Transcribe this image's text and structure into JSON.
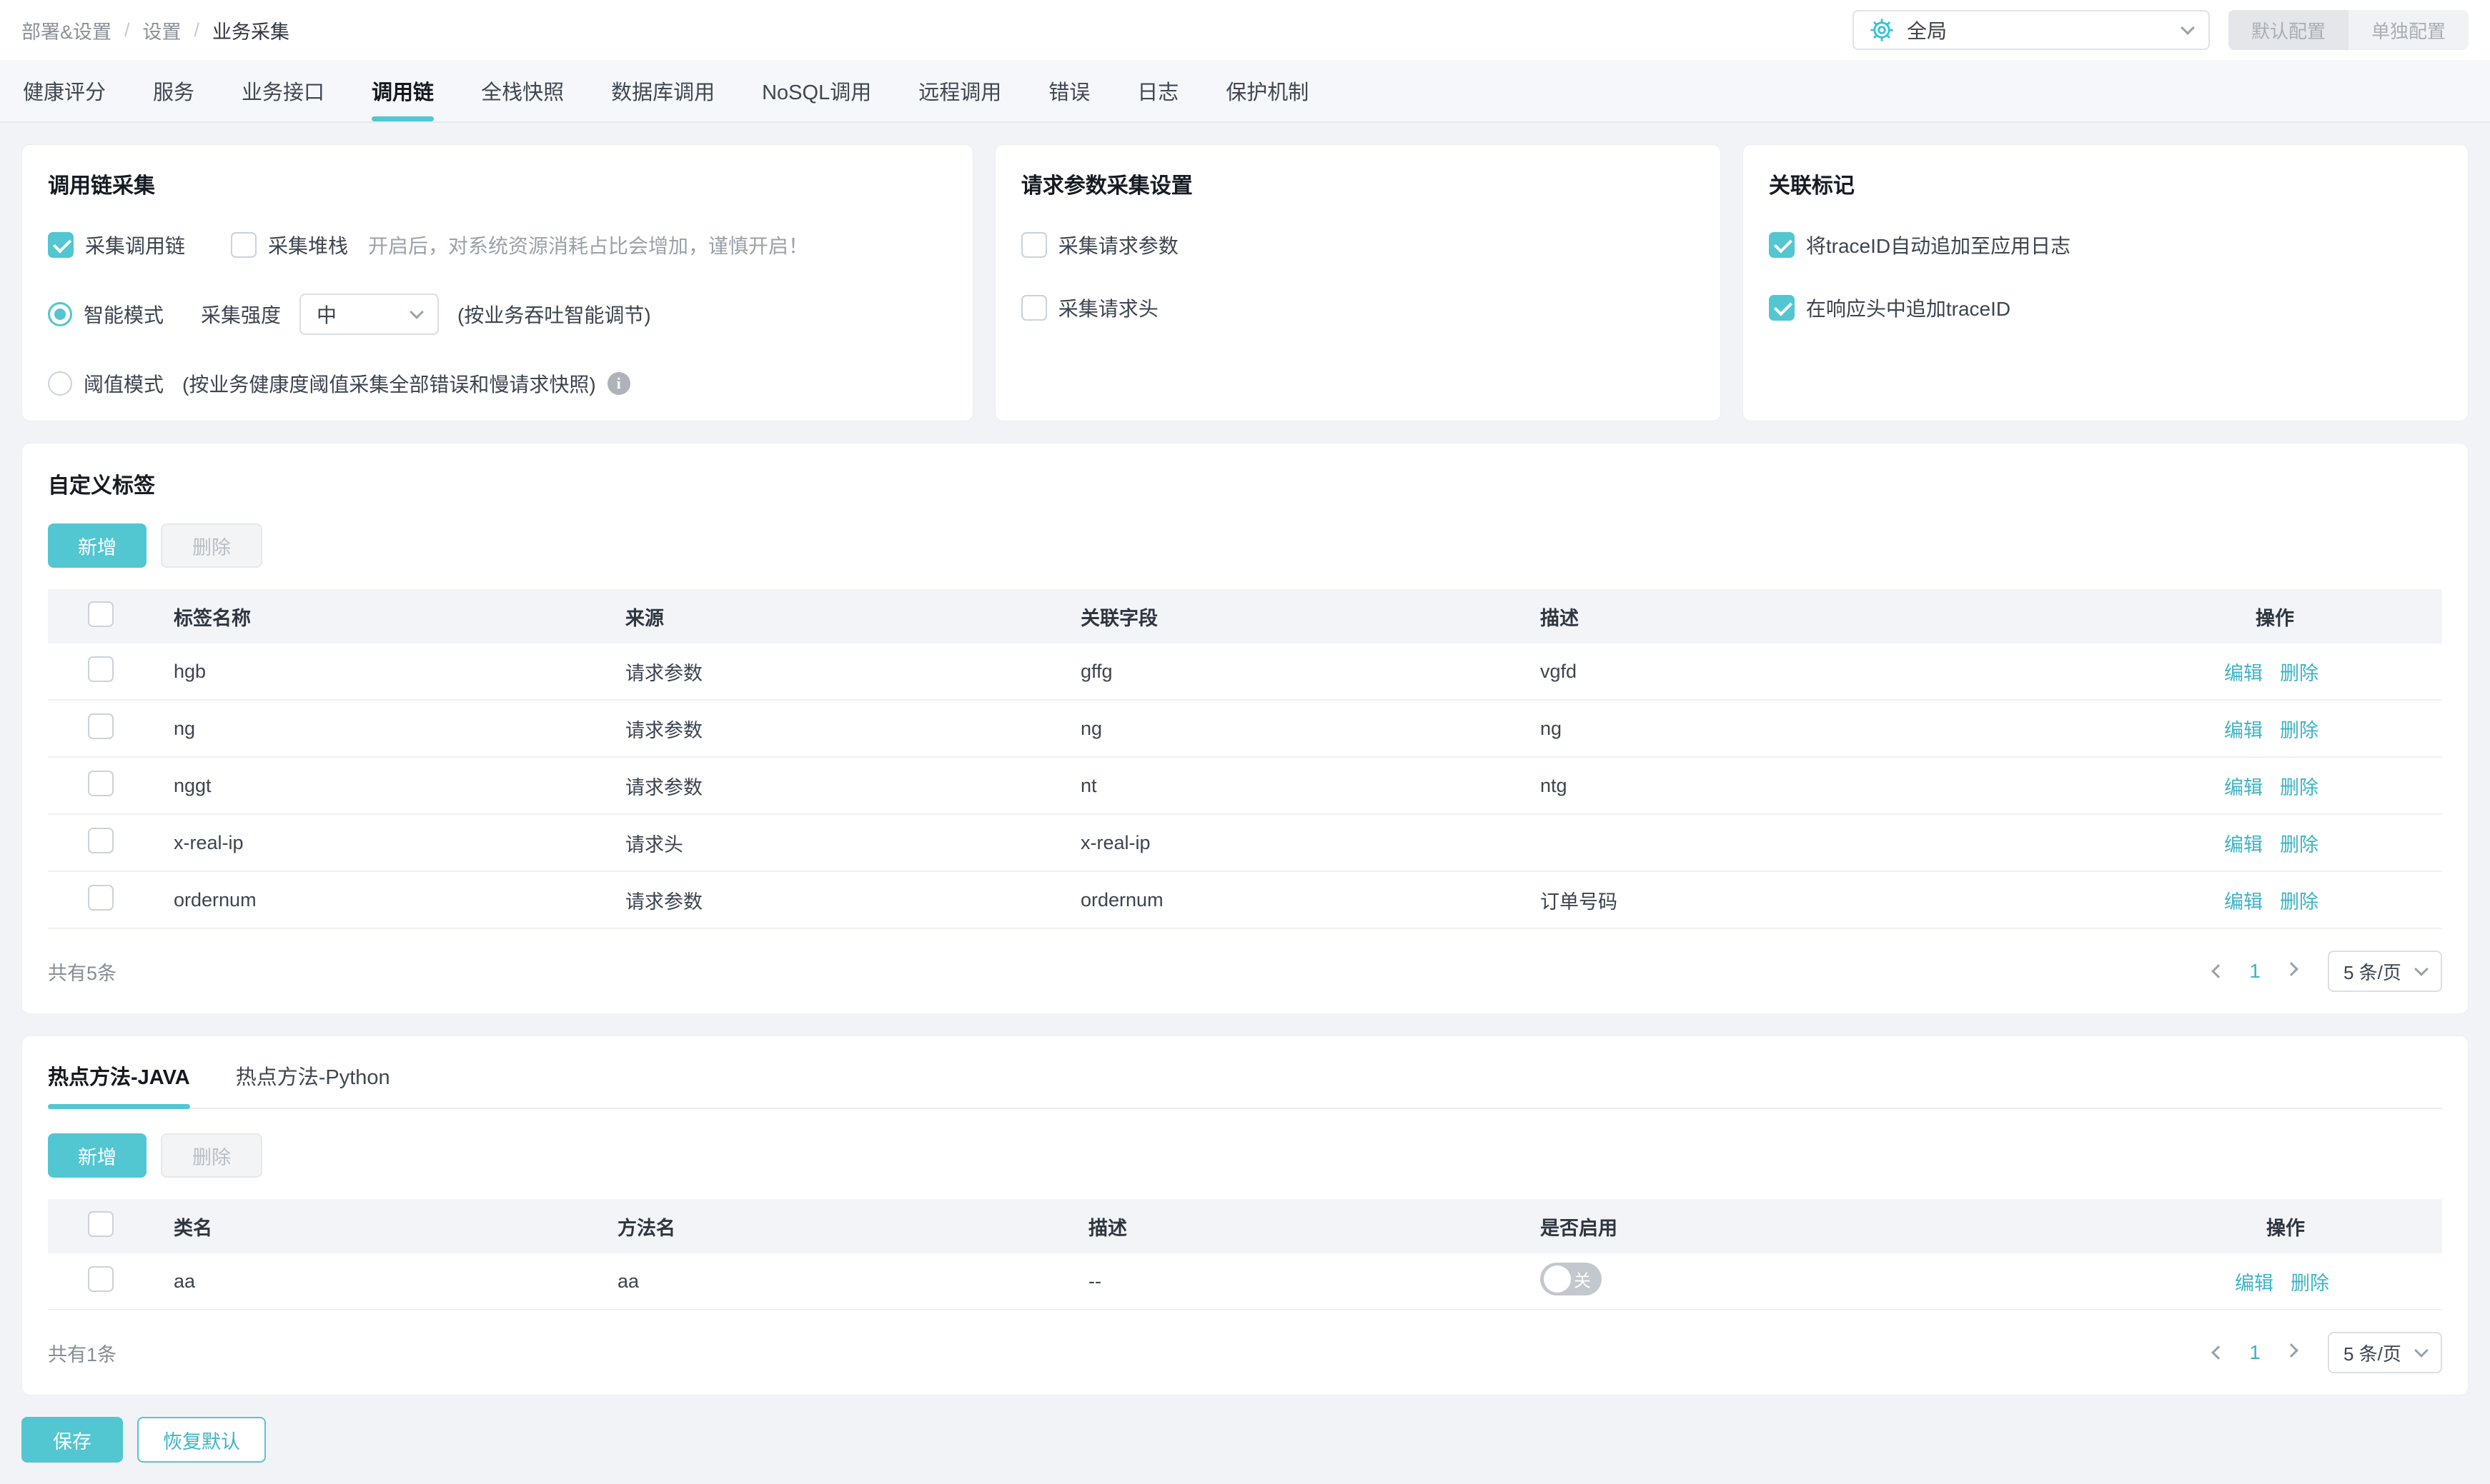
{
  "colors": {
    "accent": "#52c6d1",
    "link": "#3eb3c5"
  },
  "breadcrumb": {
    "items": [
      "部署&设置",
      "设置",
      "业务采集"
    ],
    "separator": "/"
  },
  "header": {
    "scope_value": "全局",
    "default_config_button": "默认配置",
    "separate_config_button": "单独配置"
  },
  "tabs": {
    "items": [
      "健康评分",
      "服务",
      "业务接口",
      "调用链",
      "全栈快照",
      "数据库调用",
      "NoSQL调用",
      "远程调用",
      "错误",
      "日志",
      "保护机制"
    ],
    "active": "调用链"
  },
  "panels": {
    "trace_collection": {
      "title": "调用链采集",
      "collect_trace_label": "采集调用链",
      "collect_trace_checked": true,
      "collect_stack_label": "采集堆栈",
      "collect_stack_checked": false,
      "stack_hint": "开启后，对系统资源消耗占比会增加，谨慎开启！",
      "smart_mode_label": "智能模式",
      "smart_mode_selected": true,
      "intensity_label": "采集强度",
      "intensity_value": "中",
      "smart_hint": "(按业务吞吐智能调节)",
      "threshold_mode_label": "阈值模式",
      "threshold_mode_selected": false,
      "threshold_hint": "(按业务健康度阈值采集全部错误和慢请求快照)",
      "info_glyph": "i"
    },
    "request_params": {
      "title": "请求参数采集设置",
      "collect_params_label": "采集请求参数",
      "collect_params_checked": false,
      "collect_headers_label": "采集请求头",
      "collect_headers_checked": false
    },
    "correlation": {
      "title": "关联标记",
      "append_log_label": "将traceID自动追加至应用日志",
      "append_log_checked": true,
      "append_header_label": "在响应头中追加traceID",
      "append_header_checked": true
    }
  },
  "custom_tags": {
    "title": "自定义标签",
    "add_button": "新增",
    "delete_button": "删除",
    "columns": [
      "标签名称",
      "来源",
      "关联字段",
      "描述",
      "操作"
    ],
    "edit_label": "编辑",
    "remove_label": "删除",
    "rows": [
      {
        "name": "hgb",
        "source": "请求参数",
        "field": "gffg",
        "desc": "vgfd"
      },
      {
        "name": "ng",
        "source": "请求参数",
        "field": "ng",
        "desc": "ng"
      },
      {
        "name": "nggt",
        "source": "请求参数",
        "field": "nt",
        "desc": "ntg"
      },
      {
        "name": "x-real-ip",
        "source": "请求头",
        "field": "x-real-ip",
        "desc": ""
      },
      {
        "name": "ordernum",
        "source": "请求参数",
        "field": "ordernum",
        "desc": "订单号码"
      }
    ],
    "total_text": "共有5条",
    "pagination": {
      "current_page": "1",
      "page_size": "5 条/页"
    }
  },
  "hot_methods": {
    "tabs": [
      "热点方法-JAVA",
      "热点方法-Python"
    ],
    "active_tab": "热点方法-JAVA",
    "add_button": "新增",
    "delete_button": "删除",
    "columns": [
      "类名",
      "方法名",
      "描述",
      "是否启用",
      "操作"
    ],
    "edit_label": "编辑",
    "remove_label": "删除",
    "rows": [
      {
        "class_name": "aa",
        "method_name": "aa",
        "desc": "--",
        "enabled": false,
        "toggle_label": "关"
      }
    ],
    "total_text": "共有1条",
    "pagination": {
      "current_page": "1",
      "page_size": "5 条/页"
    }
  },
  "footer": {
    "save_button": "保存",
    "reset_button": "恢复默认"
  }
}
